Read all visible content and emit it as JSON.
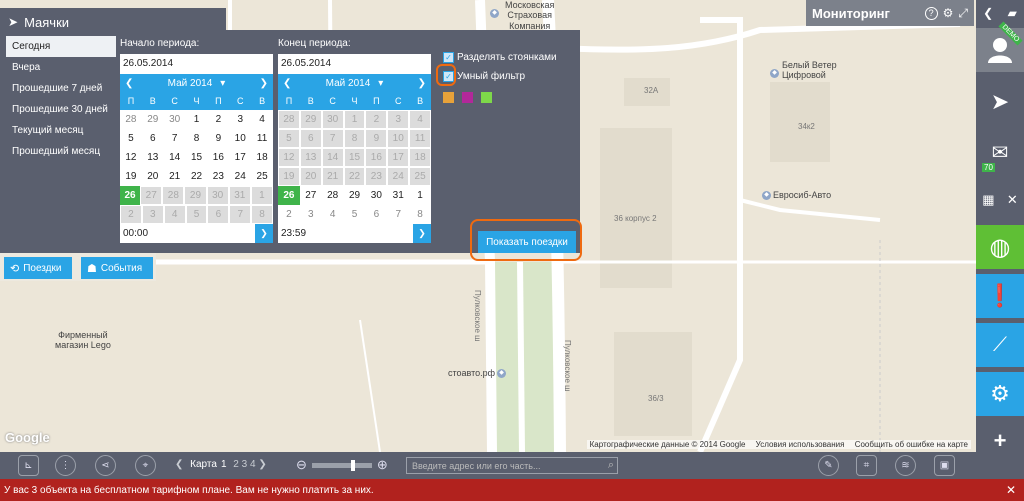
{
  "map": {
    "labels": {
      "company": "Московская\nСтраховая\nКомпания",
      "beliy_veter": "Белый Ветер\nЦифровой",
      "evrosib": "Евросиб-Авто",
      "lego": "Фирменный\nмагазин Lego",
      "stoavto": "стоавто.рф",
      "b32a": "32А",
      "b34k2": "34к2",
      "b36k2": "36 корпус 2",
      "b36_3": "36/3",
      "street1": "Пулковское ш",
      "street2": "Пулковское ш"
    },
    "google": "Google",
    "attribution": [
      "Картографические данные © 2014 Google",
      "Условия использования",
      "Сообщить об ошибке на карте"
    ]
  },
  "monitoring": {
    "title": "Мониторинг",
    "help_icon": "?"
  },
  "panel": {
    "title": "Маячки",
    "periods": [
      "Сегодня",
      "Вчера",
      "Прошедшие 7 дней",
      "Прошедшие 30 дней",
      "Текущий месяц",
      "Прошедший месяц"
    ],
    "selected_period": 0,
    "trips_button": "Поездки",
    "events_button": "События",
    "start": {
      "label": "Начало периода:",
      "date": "26.05.2014",
      "month": "Май 2014",
      "time": "00:00"
    },
    "end": {
      "label": "Конец периода:",
      "date": "26.05.2014",
      "month": "Май 2014",
      "time": "23:59"
    },
    "weekdays": [
      "П",
      "В",
      "С",
      "Ч",
      "П",
      "С",
      "В"
    ],
    "calendar": [
      [
        "28",
        "29",
        "30",
        "1",
        "2",
        "3",
        "4"
      ],
      [
        "5",
        "6",
        "7",
        "8",
        "9",
        "10",
        "11"
      ],
      [
        "12",
        "13",
        "14",
        "15",
        "16",
        "17",
        "18"
      ],
      [
        "19",
        "20",
        "21",
        "22",
        "23",
        "24",
        "25"
      ],
      [
        "26",
        "27",
        "28",
        "29",
        "30",
        "31",
        "1"
      ],
      [
        "2",
        "3",
        "4",
        "5",
        "6",
        "7",
        "8"
      ]
    ],
    "options": {
      "split_stops": "Разделять стоянками",
      "smart_filter": "Умный фильтр"
    },
    "swatch_colors": [
      "#e8a23a",
      "#b3289a",
      "#7ed84a"
    ],
    "show_trips": "Показать поездки"
  },
  "sidebar": {
    "demo": "DEMO",
    "messages_count": "70"
  },
  "bottom": {
    "map_label": "Карта",
    "maps": [
      "1",
      "2",
      "3",
      "4"
    ],
    "zoom_level": 0.7,
    "address_placeholder": "Введите адрес или его часть..."
  },
  "warning": "У вас 3 объекта на бесплатном тарифном плане. Вам не нужно платить за них.",
  "colors": {
    "accent": "#2aa4e5",
    "today": "#3fb44a",
    "highlight": "#ef6a10",
    "panel": "#5a5f6e",
    "warning": "#b1221e"
  }
}
